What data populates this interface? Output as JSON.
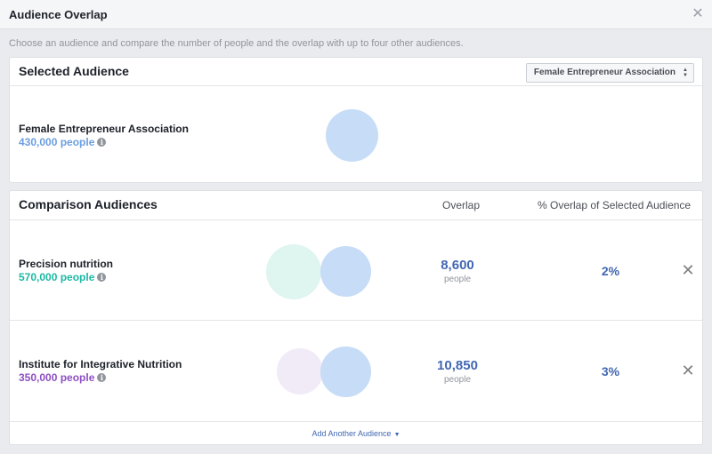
{
  "dialog": {
    "title": "Audience Overlap",
    "close_icon": "close-icon",
    "subtitle": "Choose an audience and compare the number of people and the overlap with up to four other audiences."
  },
  "selected": {
    "heading": "Selected Audience",
    "dropdown_value": "Female Entrepreneur Association",
    "audience": {
      "name": "Female Entrepreneur Association",
      "size": "430,000 people",
      "color": "#c6dcf7"
    }
  },
  "comparison": {
    "heading": "Comparison Audiences",
    "col_overlap": "Overlap",
    "col_pct": "% Overlap of Selected Audience",
    "rows": [
      {
        "name": "Precision nutrition",
        "size": "570,000 people",
        "size_color": "#1bb9a4",
        "circle_color": "#dff5ef",
        "overlap": "8,600",
        "overlap_unit": "people",
        "pct": "2%"
      },
      {
        "name": "Institute for Integrative Nutrition",
        "size": "350,000 people",
        "size_color": "#8e4fc4",
        "circle_color": "#f1eaf7",
        "overlap": "10,850",
        "overlap_unit": "people",
        "pct": "3%"
      }
    ],
    "add_label": "Add Another Audience"
  },
  "colors": {
    "accent": "#4267b2",
    "selected_circle": "#c6dcf7",
    "selected_size_text": "#6b9ee0"
  }
}
